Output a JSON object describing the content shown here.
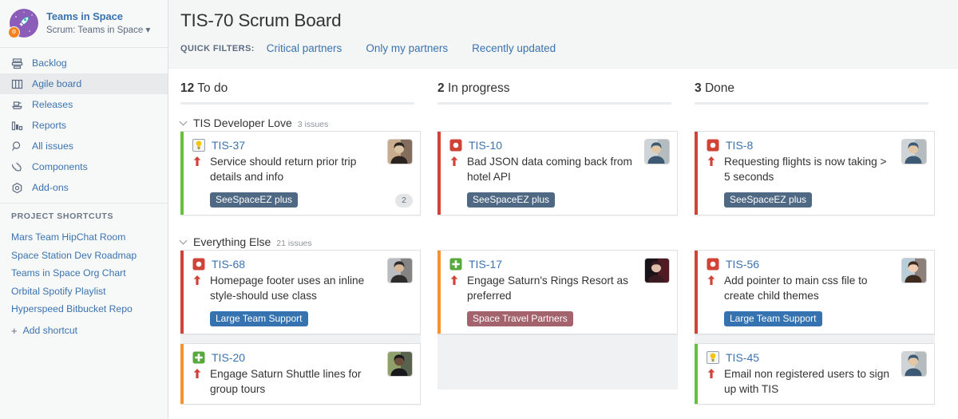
{
  "sidebar": {
    "project": {
      "name": "Teams in Space",
      "subtitle": "Scrum: Teams in Space ",
      "avatar_icon": "rocket-icon",
      "avatar_bg": "#8b5cb8",
      "badge_color": "#f58220"
    },
    "nav": [
      {
        "label": "Backlog",
        "icon": "backlog-icon",
        "active": false
      },
      {
        "label": "Agile board",
        "icon": "board-icon",
        "active": true
      },
      {
        "label": "Releases",
        "icon": "releases-icon",
        "active": false
      },
      {
        "label": "Reports",
        "icon": "reports-icon",
        "active": false
      },
      {
        "label": "All issues",
        "icon": "search-icon",
        "active": false
      },
      {
        "label": "Components",
        "icon": "components-icon",
        "active": false
      },
      {
        "label": "Add-ons",
        "icon": "addons-icon",
        "active": false
      }
    ],
    "shortcuts_title": "PROJECT SHORTCUTS",
    "shortcuts": [
      "Mars Team HipChat Room",
      "Space Station Dev Roadmap",
      "Teams in Space Org Chart",
      "Orbital Spotify Playlist",
      "Hyperspeed Bitbucket Repo"
    ],
    "add_shortcut": "Add shortcut",
    "add_shortcut_icon": "plus-icon"
  },
  "header": {
    "title": "TIS-70 Scrum Board",
    "quick_filters_label": "QUICK FILTERS:",
    "quick_filters": [
      "Critical partners",
      "Only my partners",
      "Recently updated"
    ]
  },
  "board": {
    "columns": [
      {
        "count": "12",
        "name": "To do"
      },
      {
        "count": "2",
        "name": "In progress"
      },
      {
        "count": "3",
        "name": "Done"
      }
    ],
    "swimlanes": [
      {
        "name": "TIS Developer Love",
        "count": "3 issues",
        "cells": [
          [
            {
              "key": "TIS-37",
              "summary": "Service should return prior trip details and info",
              "type": "story-icon",
              "type_color": "#f2c600",
              "priority": "priority-high-icon",
              "stripe": "#65c13b",
              "labels": [
                {
                  "text": "SeeSpaceEZ plus",
                  "color": "#4f6883"
                }
              ],
              "badge": "2",
              "avatar": "avatar-dark-woman"
            }
          ],
          [
            {
              "key": "TIS-10",
              "summary": "Bad JSON data coming back from hotel API",
              "type": "bug-icon",
              "type_color": "#d04437",
              "priority": "priority-high-icon",
              "stripe": "#d04437",
              "labels": [
                {
                  "text": "SeeSpaceEZ plus",
                  "color": "#4f6883"
                }
              ],
              "badge": null,
              "avatar": "avatar-bald-man"
            }
          ],
          [
            {
              "key": "TIS-8",
              "summary": "Requesting flights is now taking > 5 seconds",
              "type": "bug-icon",
              "type_color": "#d04437",
              "priority": "priority-high-icon",
              "stripe": "#d04437",
              "labels": [
                {
                  "text": "SeeSpaceEZ plus",
                  "color": "#4f6883"
                }
              ],
              "badge": null,
              "avatar": "avatar-bald-man"
            }
          ]
        ]
      },
      {
        "name": "Everything Else",
        "count": "21 issues",
        "cells": [
          [
            {
              "key": "TIS-68",
              "summary": "Homepage footer uses an inline style-should use class",
              "type": "bug-icon",
              "type_color": "#d04437",
              "priority": "priority-high-icon",
              "stripe": "#d04437",
              "labels": [
                {
                  "text": "Large Team Support",
                  "color": "#3572b0"
                }
              ],
              "badge": null,
              "avatar": "avatar-longhair-man"
            },
            {
              "key": "TIS-20",
              "summary": "Engage Saturn Shuttle lines for group tours",
              "type": "task-icon",
              "type_color": "#57a93c",
              "priority": "priority-high-icon",
              "stripe": "#f79232",
              "labels": [],
              "badge": null,
              "avatar": "avatar-hat-man"
            }
          ],
          [
            {
              "key": "TIS-17",
              "summary": "Engage Saturn's Rings Resort as preferred",
              "type": "task-icon",
              "type_color": "#57a93c",
              "priority": "priority-high-icon",
              "stripe": "#f79232",
              "labels": [
                {
                  "text": "Space Travel Partners",
                  "color": "#a3636c"
                }
              ],
              "badge": null,
              "avatar": "avatar-red-woman"
            }
          ],
          [
            {
              "key": "TIS-56",
              "summary": "Add pointer to main css file to create child themes",
              "type": "bug-icon",
              "type_color": "#d04437",
              "priority": "priority-high-icon",
              "stripe": "#d04437",
              "labels": [
                {
                  "text": "Large Team Support",
                  "color": "#3572b0"
                }
              ],
              "badge": null,
              "avatar": "avatar-smiling-woman"
            },
            {
              "key": "TIS-45",
              "summary": "Email non registered users to sign up with TIS",
              "type": "story-icon",
              "type_color": "#f2c600",
              "priority": "priority-high-icon",
              "stripe": "#65c13b",
              "labels": [],
              "badge": null,
              "avatar": "avatar-bald-man"
            }
          ]
        ]
      }
    ]
  }
}
